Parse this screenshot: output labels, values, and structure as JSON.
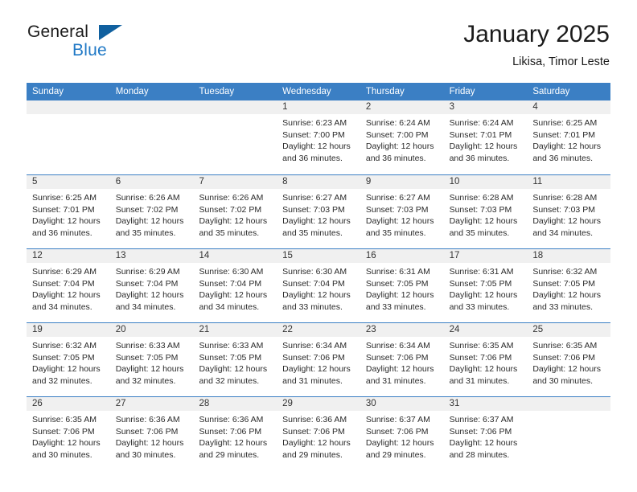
{
  "brand": {
    "name_top": "General",
    "name_bottom": "Blue",
    "accent_color": "#2079c6",
    "triangle_color": "#10609f"
  },
  "header": {
    "title": "January 2025",
    "subtitle": "Likisa, Timor Leste"
  },
  "theme": {
    "header_blue": "#3b7fc4",
    "daynum_strip": "#f0f0f0",
    "text": "#2a2a2a"
  },
  "weekdays": [
    "Sunday",
    "Monday",
    "Tuesday",
    "Wednesday",
    "Thursday",
    "Friday",
    "Saturday"
  ],
  "labels": {
    "sunrise_prefix": "Sunrise:",
    "sunset_prefix": "Sunset:",
    "daylight_prefix": "Daylight:"
  },
  "weeks": [
    [
      {
        "day": "",
        "empty": true
      },
      {
        "day": "",
        "empty": true
      },
      {
        "day": "",
        "empty": true
      },
      {
        "day": "1",
        "sunrise": "Sunrise: 6:23 AM",
        "sunset": "Sunset: 7:00 PM",
        "daylight_l1": "Daylight: 12 hours",
        "daylight_l2": "and 36 minutes."
      },
      {
        "day": "2",
        "sunrise": "Sunrise: 6:24 AM",
        "sunset": "Sunset: 7:00 PM",
        "daylight_l1": "Daylight: 12 hours",
        "daylight_l2": "and 36 minutes."
      },
      {
        "day": "3",
        "sunrise": "Sunrise: 6:24 AM",
        "sunset": "Sunset: 7:01 PM",
        "daylight_l1": "Daylight: 12 hours",
        "daylight_l2": "and 36 minutes."
      },
      {
        "day": "4",
        "sunrise": "Sunrise: 6:25 AM",
        "sunset": "Sunset: 7:01 PM",
        "daylight_l1": "Daylight: 12 hours",
        "daylight_l2": "and 36 minutes."
      }
    ],
    [
      {
        "day": "5",
        "sunrise": "Sunrise: 6:25 AM",
        "sunset": "Sunset: 7:01 PM",
        "daylight_l1": "Daylight: 12 hours",
        "daylight_l2": "and 36 minutes."
      },
      {
        "day": "6",
        "sunrise": "Sunrise: 6:26 AM",
        "sunset": "Sunset: 7:02 PM",
        "daylight_l1": "Daylight: 12 hours",
        "daylight_l2": "and 35 minutes."
      },
      {
        "day": "7",
        "sunrise": "Sunrise: 6:26 AM",
        "sunset": "Sunset: 7:02 PM",
        "daylight_l1": "Daylight: 12 hours",
        "daylight_l2": "and 35 minutes."
      },
      {
        "day": "8",
        "sunrise": "Sunrise: 6:27 AM",
        "sunset": "Sunset: 7:03 PM",
        "daylight_l1": "Daylight: 12 hours",
        "daylight_l2": "and 35 minutes."
      },
      {
        "day": "9",
        "sunrise": "Sunrise: 6:27 AM",
        "sunset": "Sunset: 7:03 PM",
        "daylight_l1": "Daylight: 12 hours",
        "daylight_l2": "and 35 minutes."
      },
      {
        "day": "10",
        "sunrise": "Sunrise: 6:28 AM",
        "sunset": "Sunset: 7:03 PM",
        "daylight_l1": "Daylight: 12 hours",
        "daylight_l2": "and 35 minutes."
      },
      {
        "day": "11",
        "sunrise": "Sunrise: 6:28 AM",
        "sunset": "Sunset: 7:03 PM",
        "daylight_l1": "Daylight: 12 hours",
        "daylight_l2": "and 34 minutes."
      }
    ],
    [
      {
        "day": "12",
        "sunrise": "Sunrise: 6:29 AM",
        "sunset": "Sunset: 7:04 PM",
        "daylight_l1": "Daylight: 12 hours",
        "daylight_l2": "and 34 minutes."
      },
      {
        "day": "13",
        "sunrise": "Sunrise: 6:29 AM",
        "sunset": "Sunset: 7:04 PM",
        "daylight_l1": "Daylight: 12 hours",
        "daylight_l2": "and 34 minutes."
      },
      {
        "day": "14",
        "sunrise": "Sunrise: 6:30 AM",
        "sunset": "Sunset: 7:04 PM",
        "daylight_l1": "Daylight: 12 hours",
        "daylight_l2": "and 34 minutes."
      },
      {
        "day": "15",
        "sunrise": "Sunrise: 6:30 AM",
        "sunset": "Sunset: 7:04 PM",
        "daylight_l1": "Daylight: 12 hours",
        "daylight_l2": "and 33 minutes."
      },
      {
        "day": "16",
        "sunrise": "Sunrise: 6:31 AM",
        "sunset": "Sunset: 7:05 PM",
        "daylight_l1": "Daylight: 12 hours",
        "daylight_l2": "and 33 minutes."
      },
      {
        "day": "17",
        "sunrise": "Sunrise: 6:31 AM",
        "sunset": "Sunset: 7:05 PM",
        "daylight_l1": "Daylight: 12 hours",
        "daylight_l2": "and 33 minutes."
      },
      {
        "day": "18",
        "sunrise": "Sunrise: 6:32 AM",
        "sunset": "Sunset: 7:05 PM",
        "daylight_l1": "Daylight: 12 hours",
        "daylight_l2": "and 33 minutes."
      }
    ],
    [
      {
        "day": "19",
        "sunrise": "Sunrise: 6:32 AM",
        "sunset": "Sunset: 7:05 PM",
        "daylight_l1": "Daylight: 12 hours",
        "daylight_l2": "and 32 minutes."
      },
      {
        "day": "20",
        "sunrise": "Sunrise: 6:33 AM",
        "sunset": "Sunset: 7:05 PM",
        "daylight_l1": "Daylight: 12 hours",
        "daylight_l2": "and 32 minutes."
      },
      {
        "day": "21",
        "sunrise": "Sunrise: 6:33 AM",
        "sunset": "Sunset: 7:05 PM",
        "daylight_l1": "Daylight: 12 hours",
        "daylight_l2": "and 32 minutes."
      },
      {
        "day": "22",
        "sunrise": "Sunrise: 6:34 AM",
        "sunset": "Sunset: 7:06 PM",
        "daylight_l1": "Daylight: 12 hours",
        "daylight_l2": "and 31 minutes."
      },
      {
        "day": "23",
        "sunrise": "Sunrise: 6:34 AM",
        "sunset": "Sunset: 7:06 PM",
        "daylight_l1": "Daylight: 12 hours",
        "daylight_l2": "and 31 minutes."
      },
      {
        "day": "24",
        "sunrise": "Sunrise: 6:35 AM",
        "sunset": "Sunset: 7:06 PM",
        "daylight_l1": "Daylight: 12 hours",
        "daylight_l2": "and 31 minutes."
      },
      {
        "day": "25",
        "sunrise": "Sunrise: 6:35 AM",
        "sunset": "Sunset: 7:06 PM",
        "daylight_l1": "Daylight: 12 hours",
        "daylight_l2": "and 30 minutes."
      }
    ],
    [
      {
        "day": "26",
        "sunrise": "Sunrise: 6:35 AM",
        "sunset": "Sunset: 7:06 PM",
        "daylight_l1": "Daylight: 12 hours",
        "daylight_l2": "and 30 minutes."
      },
      {
        "day": "27",
        "sunrise": "Sunrise: 6:36 AM",
        "sunset": "Sunset: 7:06 PM",
        "daylight_l1": "Daylight: 12 hours",
        "daylight_l2": "and 30 minutes."
      },
      {
        "day": "28",
        "sunrise": "Sunrise: 6:36 AM",
        "sunset": "Sunset: 7:06 PM",
        "daylight_l1": "Daylight: 12 hours",
        "daylight_l2": "and 29 minutes."
      },
      {
        "day": "29",
        "sunrise": "Sunrise: 6:36 AM",
        "sunset": "Sunset: 7:06 PM",
        "daylight_l1": "Daylight: 12 hours",
        "daylight_l2": "and 29 minutes."
      },
      {
        "day": "30",
        "sunrise": "Sunrise: 6:37 AM",
        "sunset": "Sunset: 7:06 PM",
        "daylight_l1": "Daylight: 12 hours",
        "daylight_l2": "and 29 minutes."
      },
      {
        "day": "31",
        "sunrise": "Sunrise: 6:37 AM",
        "sunset": "Sunset: 7:06 PM",
        "daylight_l1": "Daylight: 12 hours",
        "daylight_l2": "and 28 minutes."
      },
      {
        "day": "",
        "empty": true
      }
    ]
  ]
}
